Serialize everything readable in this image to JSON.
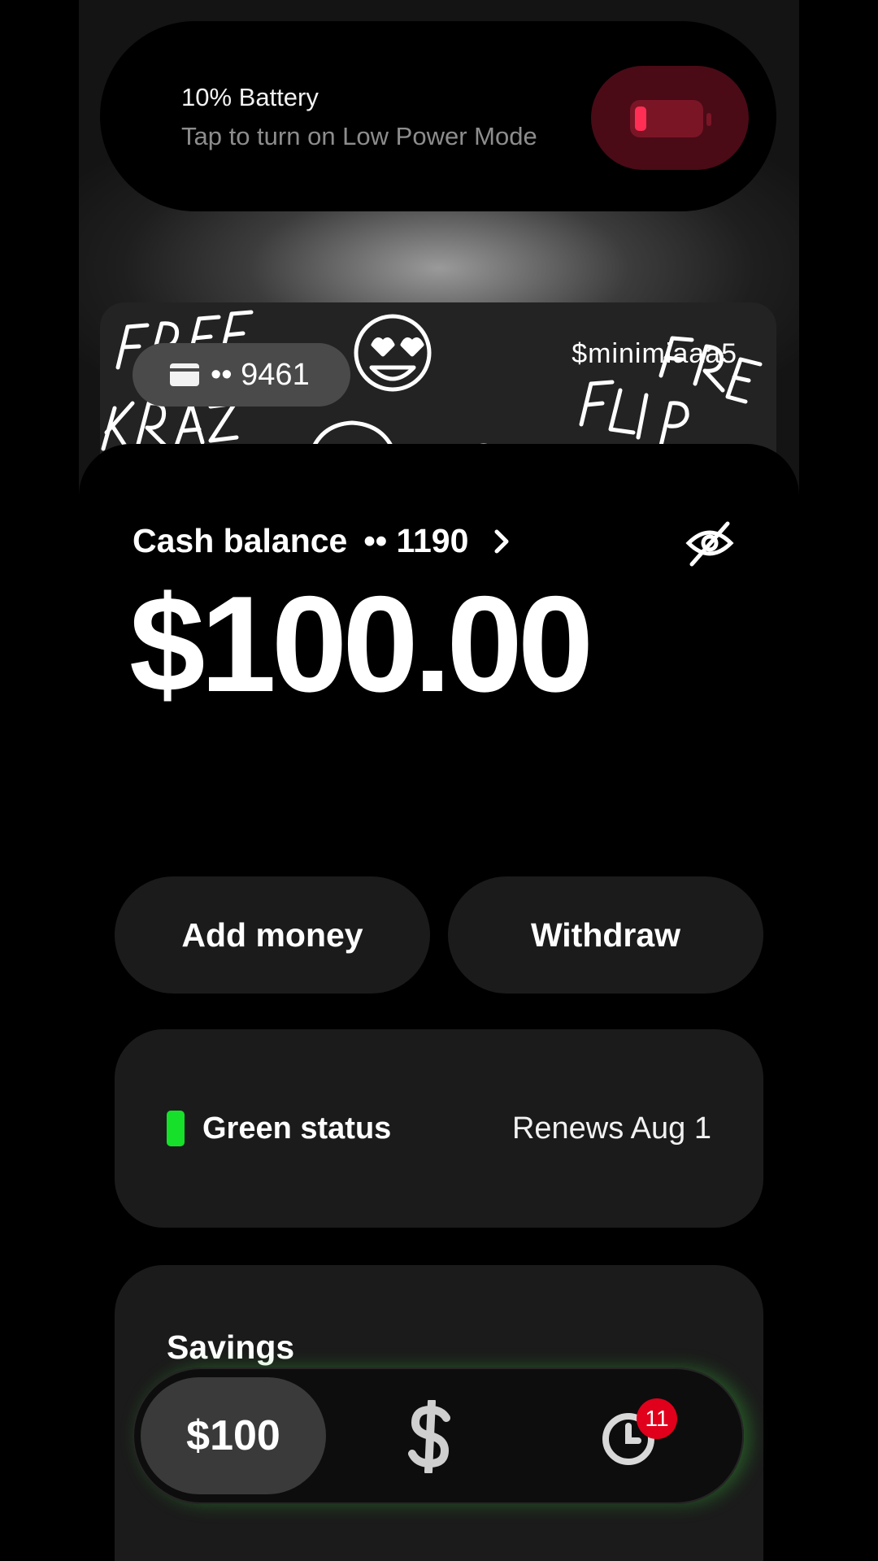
{
  "notification": {
    "title": "10% Battery",
    "subtitle": "Tap to turn on Low Power Mode",
    "battery_level_percent": 10,
    "icon": "battery-low-icon"
  },
  "card": {
    "masked_number": "•• 9461",
    "cashtag": "$minimiaaa5",
    "icon": "card-icon"
  },
  "balance": {
    "label": "Cash balance",
    "account_masked": "•• 1190",
    "amount": "$100.00",
    "hide_icon": "eye-slash-icon"
  },
  "actions": {
    "add_money": "Add money",
    "withdraw": "Withdraw"
  },
  "status": {
    "label": "Green status",
    "renews": "Renews Aug 1",
    "color": "#16e02a"
  },
  "savings": {
    "label": "Savings"
  },
  "tabbar": {
    "balance_tab": "$100",
    "pay_tab_icon": "dollar-icon",
    "activity_tab_icon": "clock-icon",
    "activity_badge": "11"
  },
  "colors": {
    "accent_green": "#16e02a",
    "battery_red": "#ff2e55",
    "badge_red": "#e0001b"
  }
}
